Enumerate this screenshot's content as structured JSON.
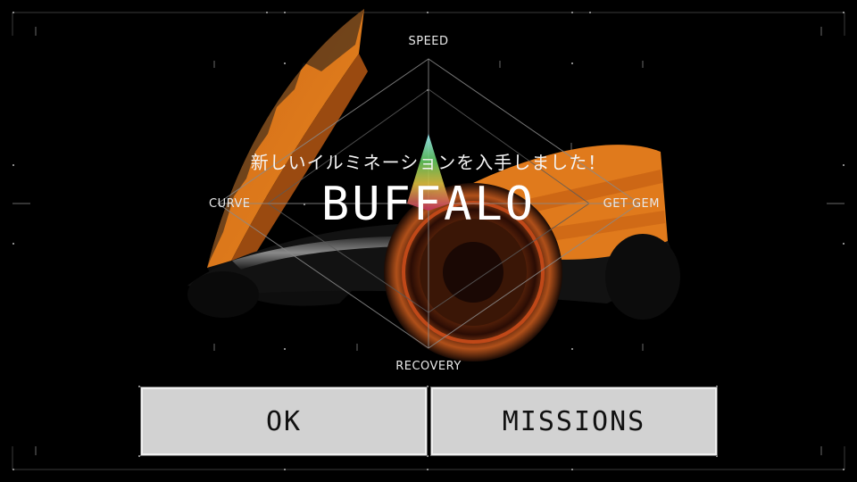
{
  "stats": {
    "speed_label": "SPEED",
    "recovery_label": "RECOVERY",
    "curve_label": "CURVE",
    "getgem_label": "GET GEM"
  },
  "dialog": {
    "message": "新しいイルミネーションを入手しました！",
    "item_name": "BUFFALO"
  },
  "buttons": {
    "ok_label": "OK",
    "missions_label": "MISSIONS"
  },
  "colors": {
    "vehicle_orange": "#e07a1c",
    "button_bg": "#d2d2d2",
    "grid_line": "#3a3a3a"
  }
}
